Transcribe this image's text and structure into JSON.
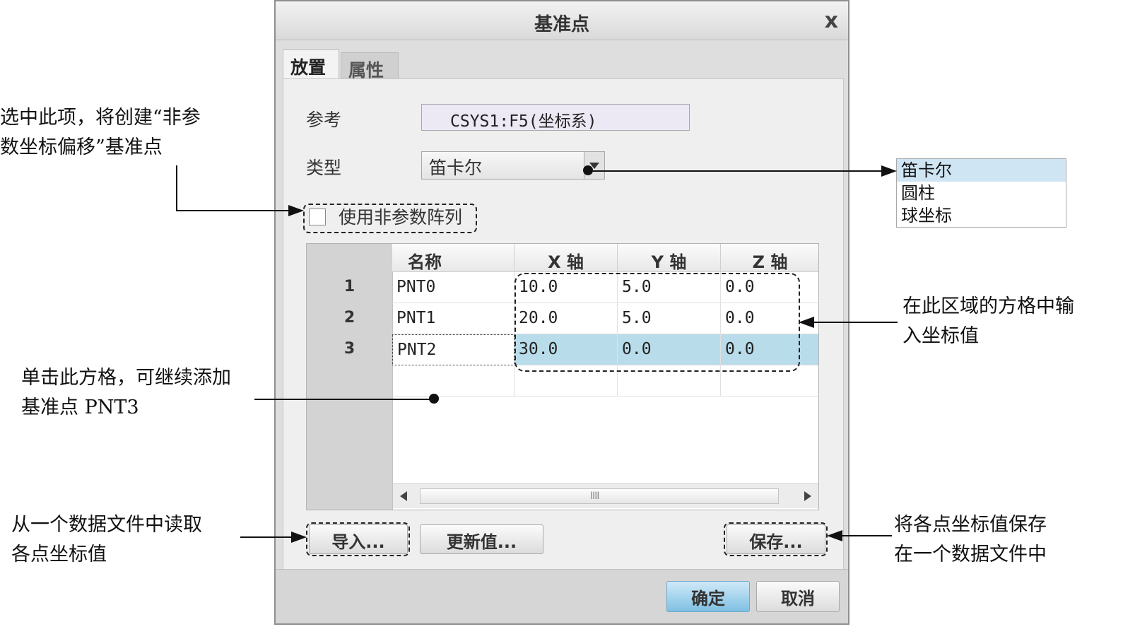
{
  "dialog": {
    "title": "基准点",
    "close_label": "x",
    "tabs": [
      {
        "label": "放置",
        "active": true
      },
      {
        "label": "属性",
        "active": false
      }
    ],
    "reference_label": "参考",
    "reference_value": "CSYS1:F5(坐标系)",
    "type_label": "类型",
    "type_value": "笛卡尔",
    "nonparam_checkbox_label": "使用非参数阵列",
    "table": {
      "columns": [
        "名称",
        "X 轴",
        "Y 轴",
        "Z 轴"
      ],
      "rows": [
        {
          "num": "1",
          "name": "PNT0",
          "x": "10.0",
          "y": "5.0",
          "z": "0.0"
        },
        {
          "num": "2",
          "name": "PNT1",
          "x": "20.0",
          "y": "5.0",
          "z": "0.0"
        },
        {
          "num": "3",
          "name": "PNT2",
          "x": "30.0",
          "y": "0.0",
          "z": "0.0",
          "selected": true
        }
      ],
      "scroll_grip": "IIII"
    },
    "buttons": {
      "import": "导入...",
      "update": "更新值...",
      "save": "保存...",
      "ok": "确定",
      "cancel": "取消"
    }
  },
  "type_dropdown": {
    "options": [
      "笛卡尔",
      "圆柱",
      "球坐标"
    ],
    "selected": "笛卡尔"
  },
  "annotations": {
    "checkbox_note_line1": "选中此项，将创建“非参",
    "checkbox_note_line2": "数坐标偏移”基准点",
    "grid_note_line1": "在此区域的方格中输",
    "grid_note_line2": "入坐标值",
    "addcell_note_line1": "单击此方格，可继续添加",
    "addcell_note_line2": "基准点 PNT3",
    "import_note_line1": "从一个数据文件中读取",
    "import_note_line2": "各点坐标值",
    "save_note_line1": "将各点坐标值保存",
    "save_note_line2": "在一个数据文件中"
  },
  "colors": {
    "dialog_bg": "#dedede",
    "panel_bg": "#efefef",
    "selected_row": "#b9dcea",
    "ok_button": "#7fc0e3",
    "dropdown_highlight": "#cfe5f4"
  }
}
